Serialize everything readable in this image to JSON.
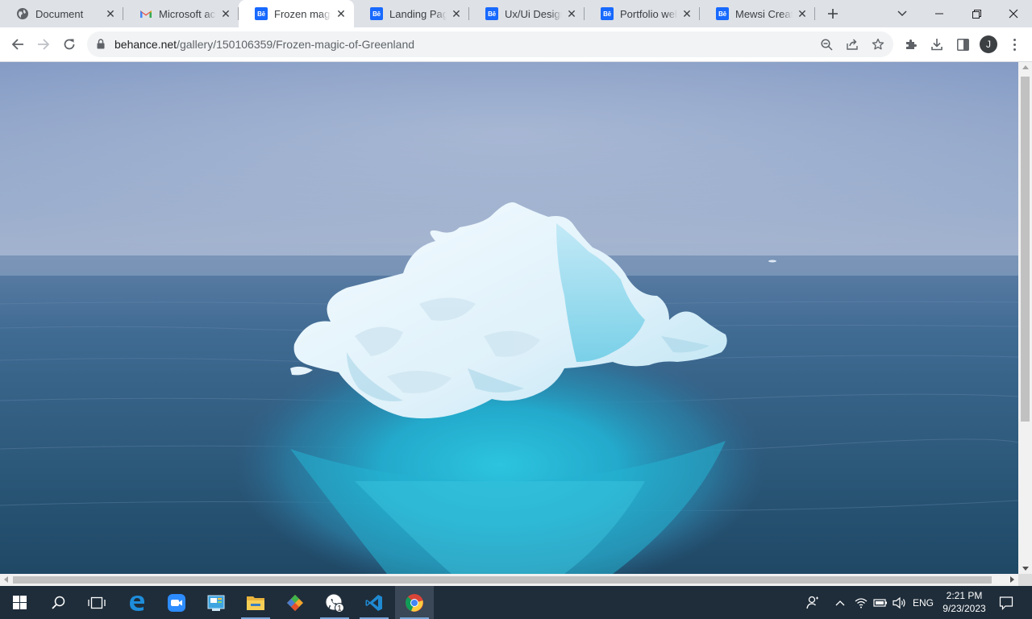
{
  "browser": {
    "tabs": [
      {
        "title": "Document",
        "favicon": "globe-icon",
        "active": false
      },
      {
        "title": "Microsoft account",
        "favicon": "gmail-icon",
        "active": false
      },
      {
        "title": "Frozen magic of Greenland",
        "favicon": "behance-icon",
        "active": true
      },
      {
        "title": "Landing Page - UI",
        "favicon": "behance-icon",
        "active": false
      },
      {
        "title": "Ux/Ui Designer",
        "favicon": "behance-icon",
        "active": false
      },
      {
        "title": "Portfolio website",
        "favicon": "behance-icon",
        "active": false
      },
      {
        "title": "Mewsi Creative",
        "favicon": "behance-icon",
        "active": false
      }
    ],
    "behance_badge": "Bē",
    "address": {
      "host": "behance.net",
      "path": "/gallery/150106359/Frozen-magic-of-Greenland"
    },
    "profile_initial": "J",
    "accent_color": "#1769ff"
  },
  "page": {
    "image_subject": "iceberg-photo",
    "colors": {
      "sky_top": "#6f87b3",
      "sea": "#2d5a7e",
      "ice": "#eaf6fb",
      "turquoise": "#1fb7d6"
    }
  },
  "taskbar": {
    "apps": [
      "start",
      "search",
      "task-view",
      "edge",
      "zoom",
      "control-panel",
      "file-explorer",
      "git",
      "whatsapp",
      "vscode",
      "chrome"
    ],
    "whatsapp_badge": "1",
    "language": "ENG",
    "time": "2:21 PM",
    "date": "9/23/2023"
  }
}
